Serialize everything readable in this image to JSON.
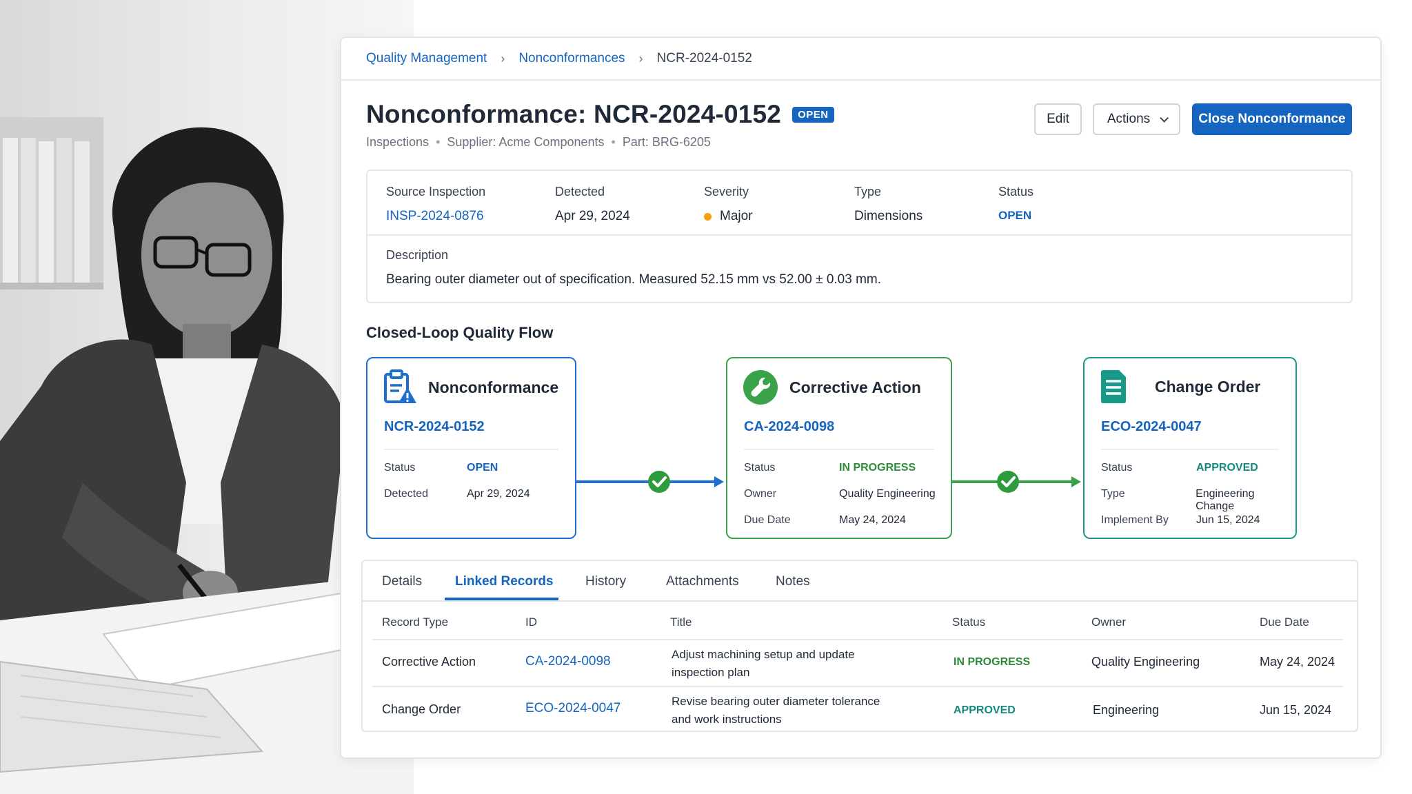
{
  "breadcrumb": {
    "items": [
      "Quality Management",
      "Nonconformances"
    ],
    "current": "NCR-2024-0152"
  },
  "header": {
    "title": "Nonconformance: NCR-2024-0152",
    "badge": "OPEN",
    "subtitle": [
      "Inspections",
      "Supplier: Acme Components",
      "Part: BRG-6205"
    ],
    "edit_label": "Edit",
    "actions_label": "Actions",
    "close_label": "Close Nonconformance"
  },
  "summary": {
    "source_inspection": {
      "label": "Source Inspection",
      "value": "INSP-2024-0876"
    },
    "detected": {
      "label": "Detected",
      "value": "Apr 29, 2024"
    },
    "severity": {
      "label": "Severity",
      "value": "Major",
      "color": "#f59e0b"
    },
    "type": {
      "label": "Type",
      "value": "Dimensions"
    },
    "status": {
      "label": "Status",
      "value": "OPEN"
    },
    "description": {
      "label": "Description",
      "value": "Bearing outer diameter out of specification. Measured 52.15 mm vs 52.00 ± 0.03 mm."
    }
  },
  "flow": {
    "title": "Closed-Loop Quality Flow",
    "nonconformance": {
      "icon": "clipboard-warning-icon",
      "title": "Nonconformance",
      "id": "NCR-2024-0152",
      "rows": [
        {
          "k": "Status",
          "v": "OPEN"
        },
        {
          "k": "Detected",
          "v": "Apr 29, 2024"
        }
      ]
    },
    "corrective_action": {
      "icon": "wrench-icon",
      "title": "Corrective Action",
      "id": "CA-2024-0098",
      "rows": [
        {
          "k": "Status",
          "v": "IN PROGRESS"
        },
        {
          "k": "Owner",
          "v": "Quality Engineering"
        },
        {
          "k": "Due Date",
          "v": "May 24, 2024"
        }
      ]
    },
    "change_order": {
      "icon": "document-icon",
      "title": "Change Order",
      "id": "ECO-2024-0047",
      "rows": [
        {
          "k": "Status",
          "v": "APPROVED"
        },
        {
          "k": "Type",
          "v": "Engineering Change"
        },
        {
          "k": "Implement By",
          "v": "Jun 15, 2024"
        }
      ]
    },
    "colors": {
      "nonconformance": "#1e6fd0",
      "corrective_action": "#3aa34a",
      "change_order": "#18998a"
    }
  },
  "tabs": [
    {
      "label": "Details"
    },
    {
      "label": "Linked Records",
      "active": true
    },
    {
      "label": "History"
    },
    {
      "label": "Attachments"
    },
    {
      "label": "Notes"
    }
  ],
  "table": {
    "columns": [
      "Record Type",
      "ID",
      "Title",
      "Status",
      "Owner",
      "Due Date"
    ],
    "rows": [
      {
        "type": "Corrective Action",
        "id": "CA-2024-0098",
        "title": "Adjust machining setup and update inspection plan",
        "status": "IN PROGRESS",
        "owner": "Quality Engineering",
        "due": "May 24, 2024"
      },
      {
        "type": "Change Order",
        "id": "ECO-2024-0047",
        "title": "Revise bearing outer diameter tolerance and work instructions",
        "status": "APPROVED",
        "owner": "Engineering",
        "due": "Jun 15, 2024"
      }
    ]
  }
}
